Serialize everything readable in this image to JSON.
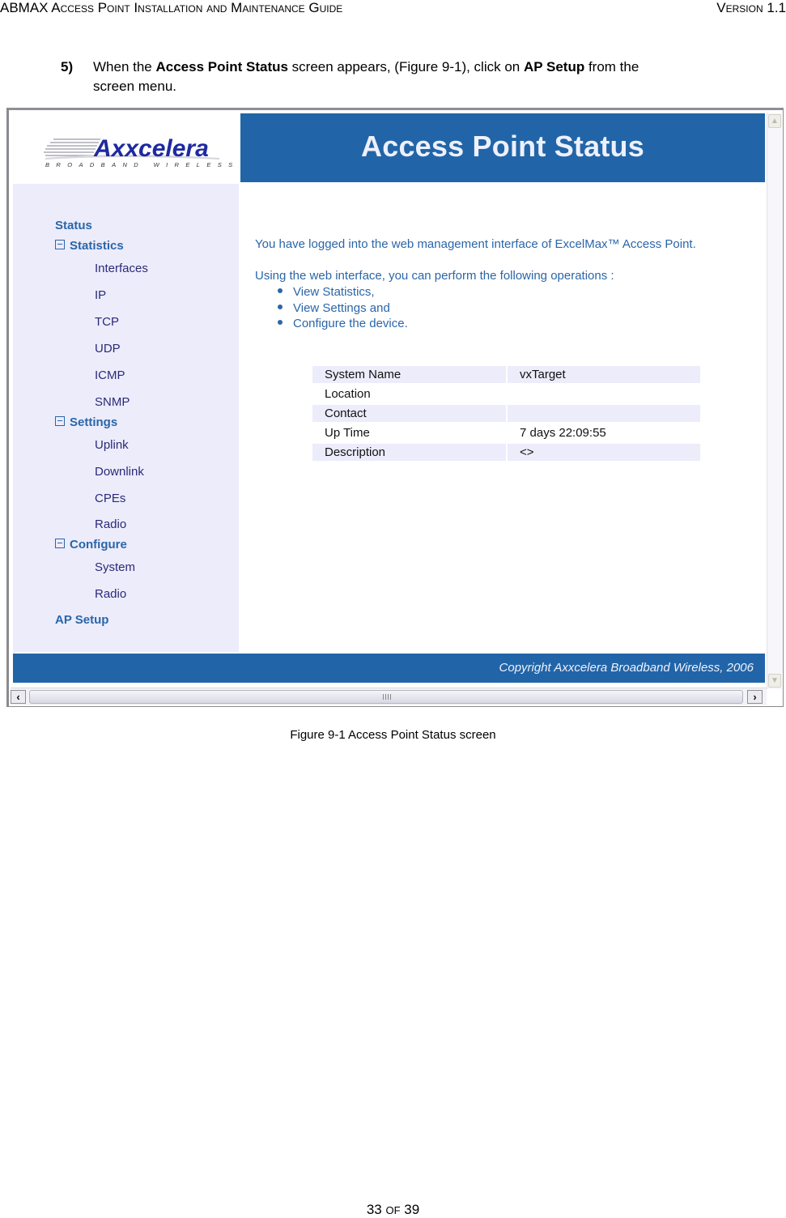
{
  "document": {
    "header_left": "ABMAX Access Point Installation and Maintenance Guide",
    "header_right": "Version 1.1",
    "step": {
      "number": "5)",
      "text_before": "When the ",
      "bold1": "Access Point Status",
      "text_middle": " screen appears, (Figure 9-1), click on ",
      "bold2": "AP Setup",
      "text_after_line1": " from the",
      "text_line2": "screen menu."
    },
    "caption": "Figure 9-1 Access Point Status screen",
    "page": {
      "current": "33",
      "of_label": "of",
      "total": "39"
    }
  },
  "screen": {
    "logo": {
      "brand": "Axxcelera",
      "tagline": "BROADBAND WIRELESS"
    },
    "title": "Access Point Status",
    "colors": {
      "header_blue": "#2165a8",
      "sidebar_bg": "#ececfb",
      "link_blue": "#2a66a8",
      "sub_link": "#2a2a78"
    },
    "sidebar": {
      "status": "Status",
      "statistics": {
        "label": "Statistics",
        "items": [
          "Interfaces",
          "IP",
          "TCP",
          "UDP",
          "ICMP",
          "SNMP"
        ]
      },
      "settings": {
        "label": "Settings",
        "items": [
          "Uplink",
          "Downlink",
          "CPEs",
          "Radio"
        ]
      },
      "configure": {
        "label": "Configure",
        "items": [
          "System",
          "Radio"
        ]
      },
      "ap_setup": "AP Setup"
    },
    "main": {
      "intro": "You have logged into the web management interface of ExcelMax™ Access Point.",
      "ops_intro": "Using the web interface, you can perform the following operations :",
      "ops": [
        "View Statistics,",
        "View Settings and",
        "Configure the device."
      ],
      "info": [
        {
          "key": "System Name",
          "value": "vxTarget"
        },
        {
          "key": "Location",
          "value": ""
        },
        {
          "key": "Contact",
          "value": ""
        },
        {
          "key": "Up Time",
          "value": "7 days 22:09:55"
        },
        {
          "key": "Description",
          "value": "<>"
        }
      ]
    },
    "footer": "Copyright Axxcelera Broadband Wireless, 2006"
  }
}
